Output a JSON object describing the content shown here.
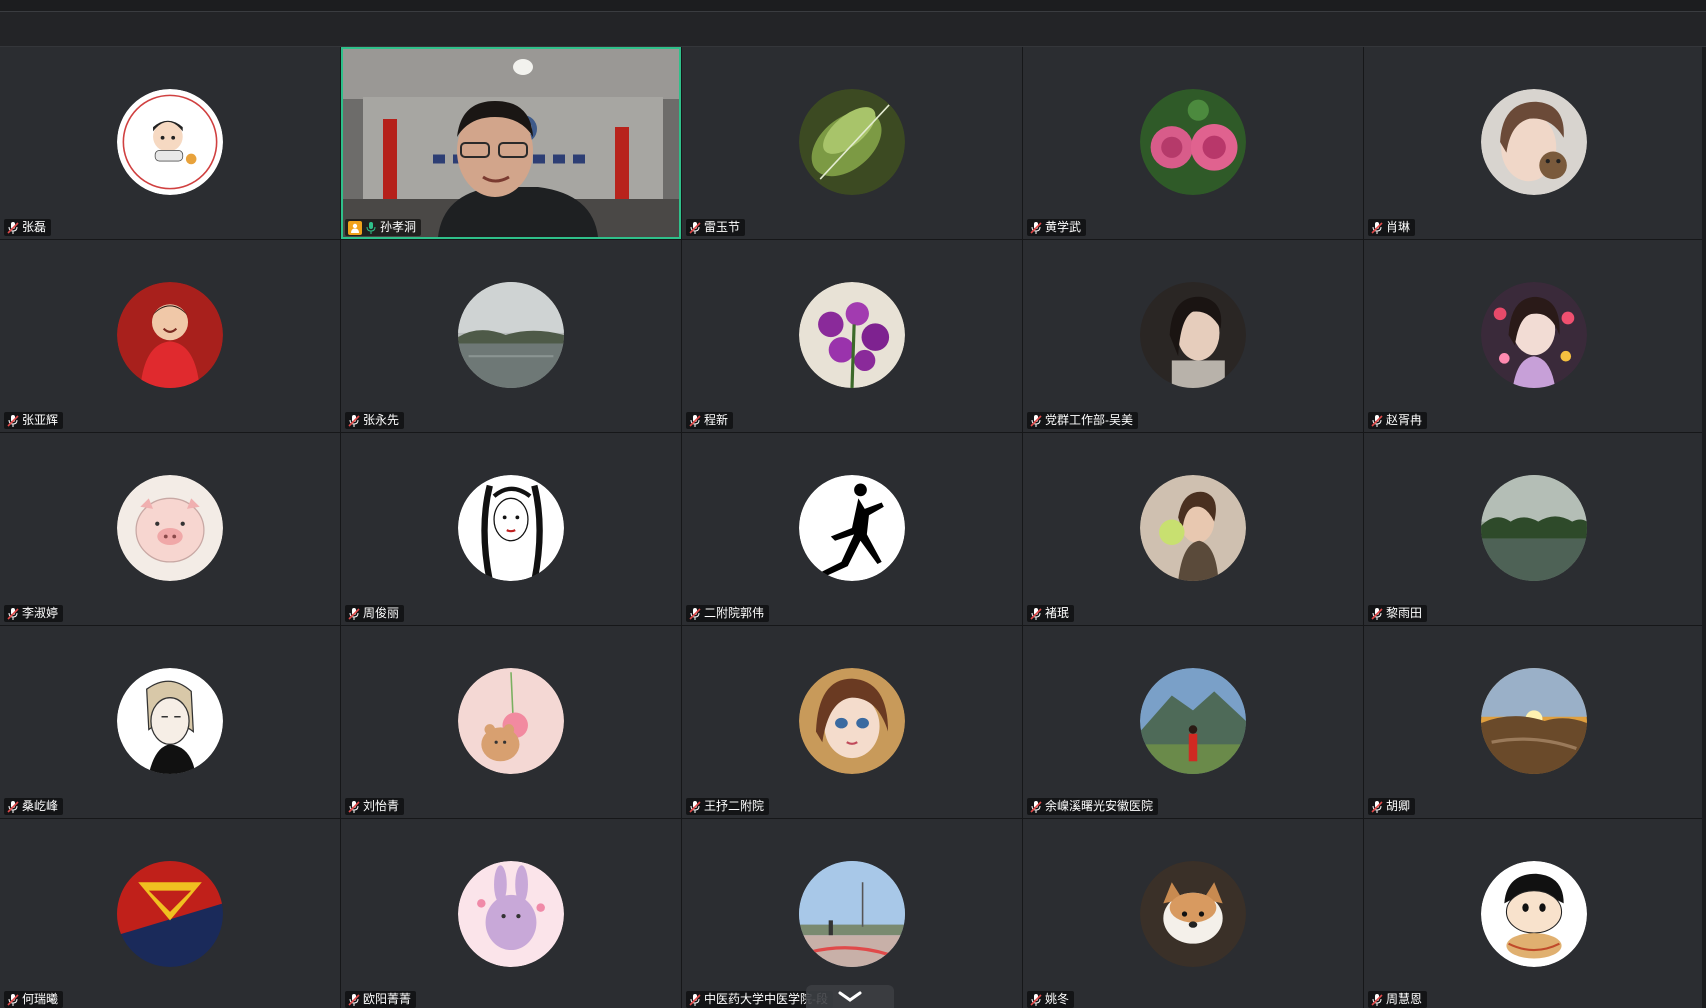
{
  "active_speaker": "孙孝洞",
  "participants": [
    {
      "name": "张磊",
      "avatar": "avatar-cartoon-boy-seal",
      "muted": true
    },
    {
      "name": "孙孝洞",
      "video": true,
      "host": true,
      "speaking": true
    },
    {
      "name": "雷玉节",
      "avatar": "avatar-green-leaf",
      "muted": true
    },
    {
      "name": "黄学武",
      "avatar": "avatar-pink-roses",
      "muted": true
    },
    {
      "name": "肖琳",
      "avatar": "avatar-girl-with-bear",
      "muted": true
    },
    {
      "name": "张亚辉",
      "avatar": "avatar-child-red-coat",
      "muted": true
    },
    {
      "name": "张永先",
      "avatar": "avatar-lake-scene",
      "muted": true
    },
    {
      "name": "程新",
      "avatar": "avatar-purple-orchids",
      "muted": true
    },
    {
      "name": "党群工作部-吴美",
      "avatar": "avatar-woman-dark",
      "muted": true
    },
    {
      "name": "赵胥冉",
      "avatar": "avatar-girl-hearts",
      "muted": true
    },
    {
      "name": "李淑婷",
      "avatar": "avatar-cartoon-pig",
      "muted": true
    },
    {
      "name": "周俊丽",
      "avatar": "avatar-line-art-girl",
      "muted": true
    },
    {
      "name": "二附院郭伟",
      "avatar": "avatar-jumpman-logo",
      "muted": true
    },
    {
      "name": "褚珉",
      "avatar": "avatar-woman-balloon",
      "muted": true
    },
    {
      "name": "黎雨田",
      "avatar": "avatar-lake-trees",
      "muted": true
    },
    {
      "name": "桑屹峰",
      "avatar": "avatar-cartoon-man",
      "muted": true
    },
    {
      "name": "刘怡青",
      "avatar": "avatar-bear-cherry",
      "muted": true
    },
    {
      "name": "王抒二附院",
      "avatar": "avatar-painted-girl",
      "muted": true
    },
    {
      "name": "余嵲溪曙光安徽医院",
      "avatar": "avatar-mountain-person",
      "muted": true
    },
    {
      "name": "胡卿",
      "avatar": "avatar-sunset",
      "muted": true
    },
    {
      "name": "何瑞曦",
      "avatar": "avatar-superman-logo",
      "muted": true
    },
    {
      "name": "欧阳菁菁",
      "avatar": "avatar-pink-bunny",
      "muted": true
    },
    {
      "name": "中医药大学中医学院-段",
      "avatar": "avatar-street-scene",
      "muted": true
    },
    {
      "name": "姚冬",
      "avatar": "avatar-puppy",
      "muted": true
    },
    {
      "name": "周慧恩",
      "avatar": "avatar-shin-chan",
      "muted": true
    }
  ],
  "colors": {
    "active_border": "#2fc08a",
    "host_badge": "#f0a21b",
    "tile_bg": "#2b2d31",
    "muted_mic": "#e04a4a"
  }
}
